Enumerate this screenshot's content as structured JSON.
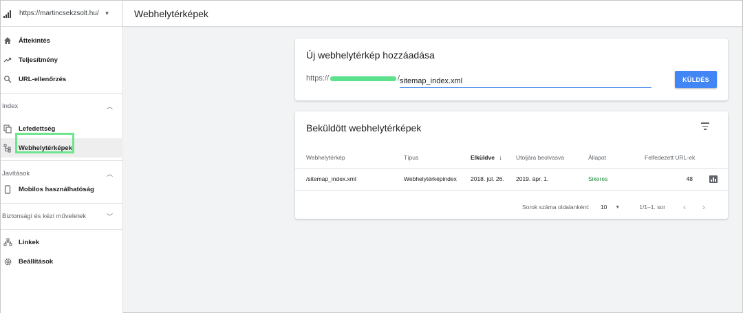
{
  "sidebar": {
    "property": "https://martincsekzsolt.hu/",
    "items": [
      {
        "label": "Áttekintés",
        "icon": "home-icon"
      },
      {
        "label": "Teljesítmény",
        "icon": "trending-up-icon"
      },
      {
        "label": "URL-ellenőrzés",
        "icon": "search-icon"
      }
    ],
    "index_group": "Index",
    "index_items": [
      {
        "label": "Lefedettség",
        "icon": "copy-icon"
      },
      {
        "label": "Webhelytérképek",
        "icon": "sitemap-icon"
      }
    ],
    "fixes_group": "Javítások",
    "fixes_items": [
      {
        "label": "Mobilos használhatóság",
        "icon": "phone-icon"
      }
    ],
    "security_group": "Biztonsági és kézi műveletek",
    "bottom_items": [
      {
        "label": "Linkek",
        "icon": "links-icon"
      },
      {
        "label": "Beállítások",
        "icon": "gear-icon"
      }
    ]
  },
  "header": {
    "title": "Webhelytérképek"
  },
  "add_card": {
    "title": "Új webhelytérkép hozzáadása",
    "prefix": "https://",
    "suffix": "/",
    "input_value": "sitemap_index.xml",
    "submit_label": "KÜLDÉS"
  },
  "submitted_card": {
    "title": "Beküldött webhelytérképek",
    "columns": [
      "Webhelytérkép",
      "Típus",
      "Elküldve",
      "Utoljára beolvasva",
      "Állapot",
      "Felfedezett URL-ek"
    ],
    "sort_arrow": "↓",
    "rows": [
      {
        "sitemap": "/sitemap_index.xml",
        "type": "Webhelytérképindex",
        "submitted": "2018. júl. 26.",
        "last_read": "2019. ápr. 1.",
        "status": "Sikeres",
        "urls": "48"
      }
    ],
    "pager": {
      "rows_label": "Sorok száma oldalanként:",
      "rows_value": "10",
      "range": "1/1–1. sor"
    }
  },
  "colors": {
    "accent": "#4285f4",
    "success": "#1e8e3e",
    "highlight": "#6de68e"
  }
}
